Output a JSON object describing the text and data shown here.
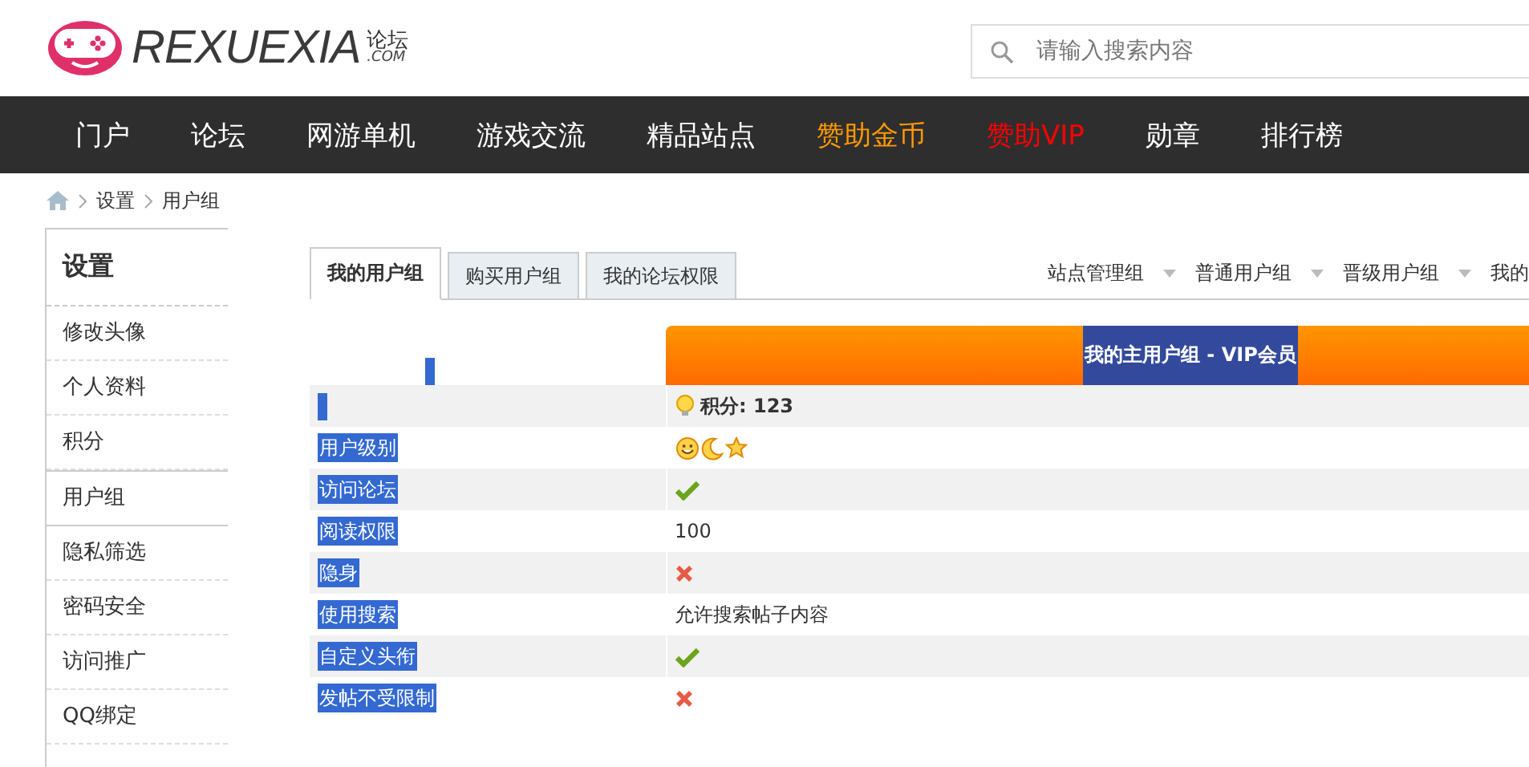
{
  "header": {
    "logo": {
      "name": "REXUEXIA",
      "suffix_top": "论坛",
      "suffix_bottom": ".COM"
    },
    "search": {
      "placeholder": "请输入搜索内容"
    }
  },
  "nav": [
    {
      "label": "门户",
      "color": "#ffffff"
    },
    {
      "label": "论坛",
      "color": "#ffffff"
    },
    {
      "label": "网游单机",
      "color": "#ffffff"
    },
    {
      "label": "游戏交流",
      "color": "#ffffff"
    },
    {
      "label": "精品站点",
      "color": "#ffffff"
    },
    {
      "label": "赞助金币",
      "color": "#ff9900"
    },
    {
      "label": "赞助VIP",
      "color": "#ff0000"
    },
    {
      "label": "勋章",
      "color": "#ffffff"
    },
    {
      "label": "排行榜",
      "color": "#ffffff"
    }
  ],
  "breadcrumb": [
    "设置",
    "用户组"
  ],
  "sidebar": {
    "title": "设置",
    "items": [
      {
        "label": "修改头像",
        "selected": false
      },
      {
        "label": "个人资料",
        "selected": false
      },
      {
        "label": "积分",
        "selected": false
      },
      {
        "label": "用户组",
        "selected": true
      },
      {
        "label": "隐私筛选",
        "selected": false
      },
      {
        "label": "密码安全",
        "selected": false
      },
      {
        "label": "访问推广",
        "selected": false
      },
      {
        "label": "QQ绑定",
        "selected": false
      }
    ]
  },
  "tabs": [
    {
      "label": "我的用户组",
      "selected": true
    },
    {
      "label": "购买用户组",
      "selected": false
    },
    {
      "label": "我的论坛权限",
      "selected": false
    }
  ],
  "group_links": [
    {
      "label": "站点管理组",
      "dropdown": true
    },
    {
      "label": "普通用户组",
      "dropdown": true
    },
    {
      "label": "晋级用户组",
      "dropdown": true
    },
    {
      "label": "我的",
      "dropdown": false
    }
  ],
  "table": {
    "header": "我的主用户组 - VIP会员",
    "points": "积分: 123",
    "labels_selected": true,
    "rows": [
      {
        "label": "用户级别",
        "kind": "icons"
      },
      {
        "label": "访问论坛",
        "kind": "yes"
      },
      {
        "label": "阅读权限",
        "kind": "text",
        "value": "100"
      },
      {
        "label": "隐身",
        "kind": "no"
      },
      {
        "label": "使用搜索",
        "kind": "text",
        "value": "允许搜索帖子内容"
      },
      {
        "label": "自定义头衔",
        "kind": "yes"
      },
      {
        "label": "发帖不受限制",
        "kind": "no"
      }
    ]
  }
}
